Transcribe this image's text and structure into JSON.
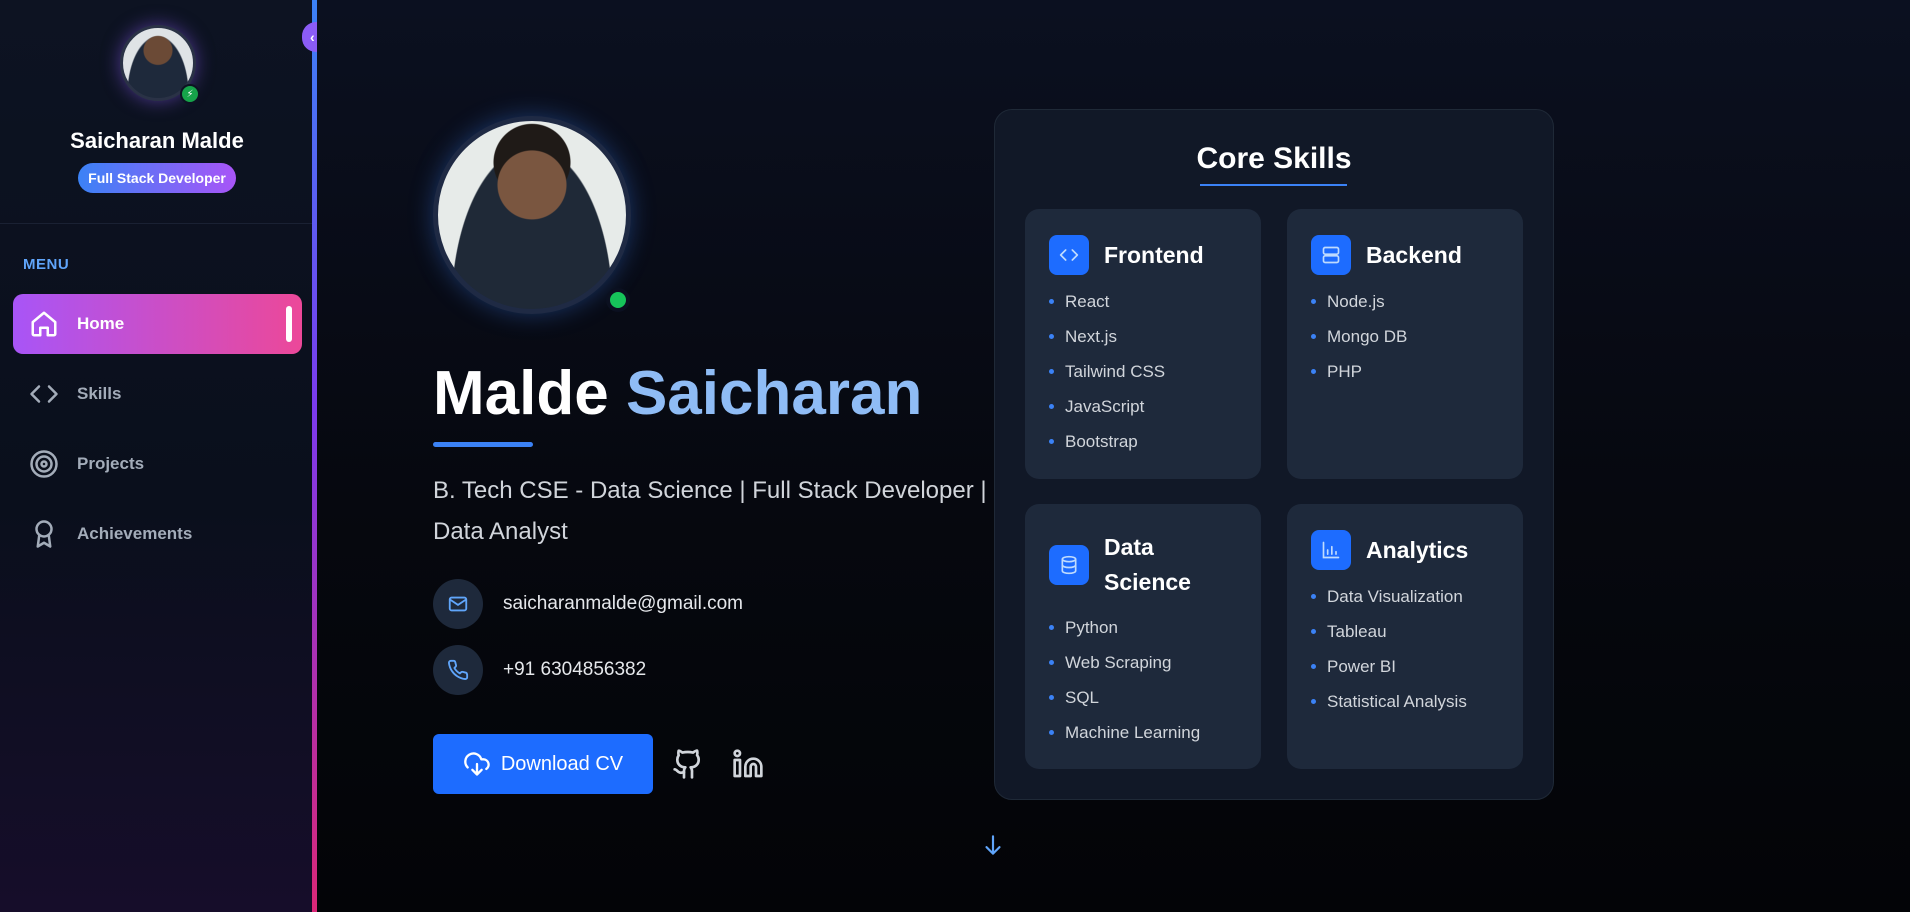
{
  "sidebar": {
    "profile_name": "Saicharan Malde",
    "profile_role": "Full Stack Developer",
    "menu_label": "MENU",
    "items": [
      {
        "label": "Home",
        "icon": "home-icon",
        "active": true
      },
      {
        "label": "Skills",
        "icon": "code-icon",
        "active": false
      },
      {
        "label": "Projects",
        "icon": "target-icon",
        "active": false
      },
      {
        "label": "Achievements",
        "icon": "award-icon",
        "active": false
      }
    ]
  },
  "hero": {
    "first_name": "Malde",
    "last_name": "Saicharan",
    "subtitle": "B. Tech CSE - Data Science  |  Full Stack Developer  |  Data Analyst",
    "email": "saicharanmalde@gmail.com",
    "phone": "+91 6304856382",
    "download_label": "Download CV"
  },
  "skills": {
    "title": "Core Skills",
    "groups": [
      {
        "name": "Frontend",
        "icon": "code-icon",
        "items": [
          "React",
          "Next.js",
          "Tailwind CSS",
          "JavaScript",
          "Bootstrap"
        ]
      },
      {
        "name": "Backend",
        "icon": "server-icon",
        "items": [
          "Node.js",
          "Mongo DB",
          "PHP"
        ]
      },
      {
        "name": "Data Science",
        "icon": "database-icon",
        "items": [
          "Python",
          "Web Scraping",
          "SQL",
          "Machine Learning"
        ]
      },
      {
        "name": "Analytics",
        "icon": "bar-chart-icon",
        "items": [
          "Data Visualization",
          "Tableau",
          "Power BI",
          "Statistical Analysis"
        ]
      }
    ]
  },
  "colors": {
    "accent_blue": "#1d6cff",
    "accent_purple": "#a855f7",
    "accent_pink": "#ec4899",
    "status_green": "#16c45a"
  }
}
